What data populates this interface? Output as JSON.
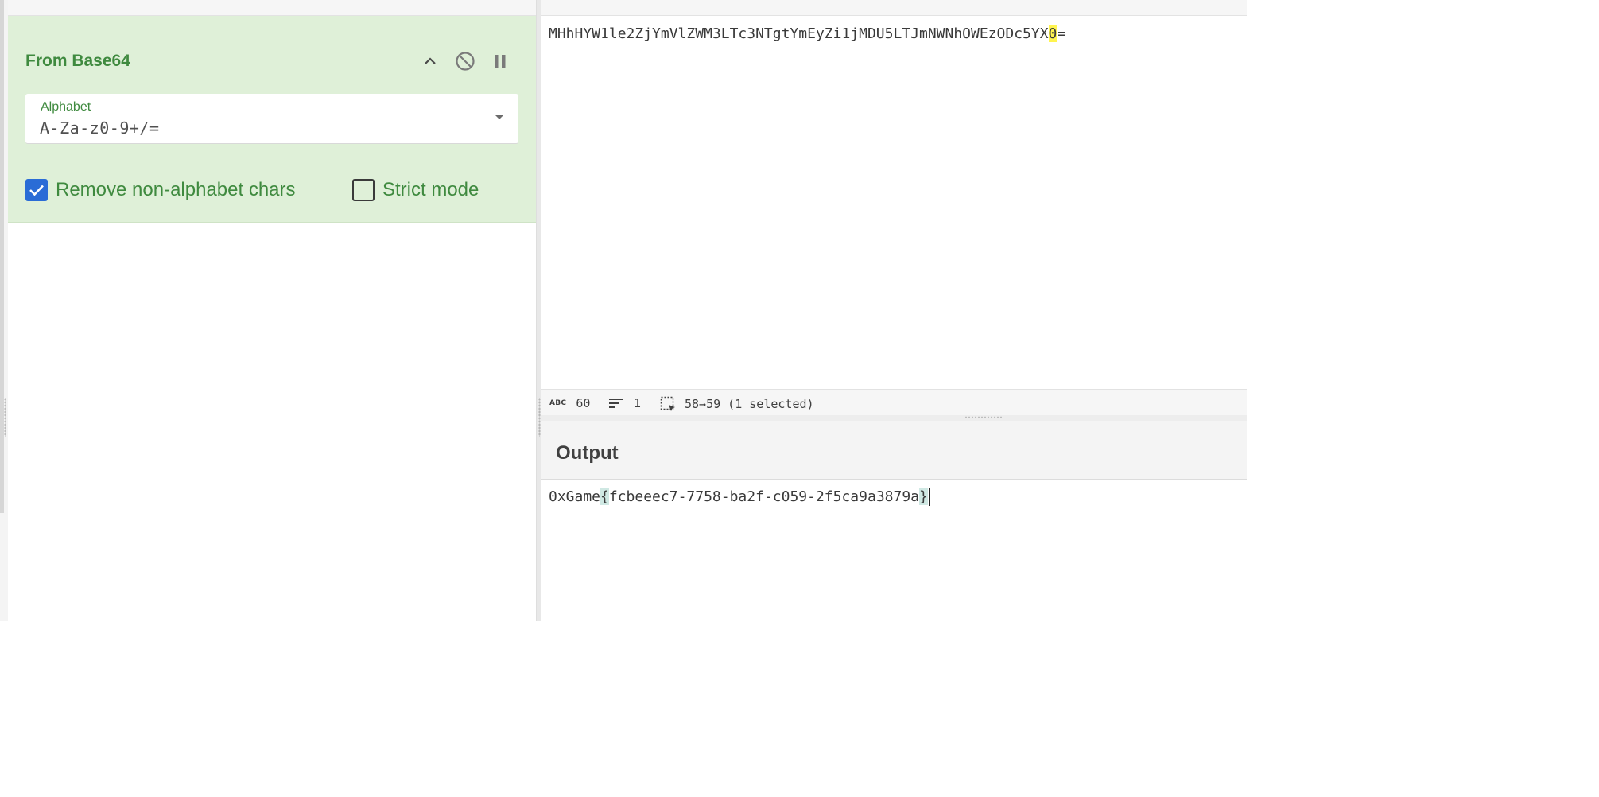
{
  "recipe": {
    "operation_title": "From Base64",
    "alphabet": {
      "label": "Alphabet",
      "value": "A-Za-z0-9+/="
    },
    "options": [
      {
        "label": "Remove non-alphabet chars",
        "checked": true
      },
      {
        "label": "Strict mode",
        "checked": false
      }
    ],
    "controls": [
      "chevron-up-icon",
      "disable-icon",
      "pause-icon"
    ]
  },
  "input": {
    "text_before": "MHhHYW1le2ZjYmVlZWM3LTc3NTgtYmEyZi1jMDU5LTJmNWNhOWEzODc5YX",
    "text_selected": "0",
    "text_after": "=",
    "status": {
      "length": "60",
      "lines": "1",
      "selection": "58→59 (1 selected)"
    }
  },
  "output": {
    "title": "Output",
    "text_pre": "0xGame",
    "brace_open": "{",
    "text_mid": "fcbeeec7-7758-ba2f-c059-2f5ca9a3879a",
    "brace_close": "}"
  },
  "colors": {
    "operation_bg": "#dff0d8",
    "operation_text": "#3f8a3f",
    "checkbox_on": "#2a6cd6",
    "selection_highlight": "#fff44f",
    "bracket_highlight": "#cfe8e3"
  }
}
